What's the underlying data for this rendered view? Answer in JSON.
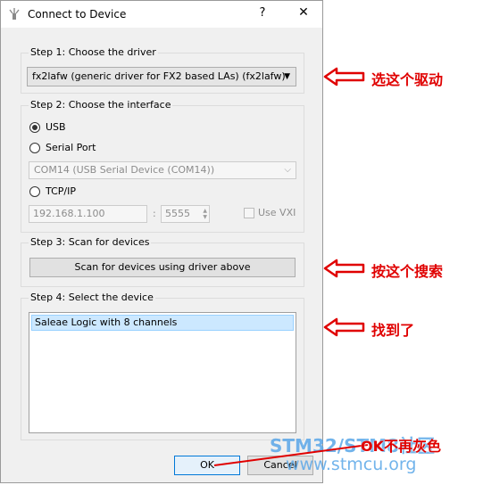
{
  "window": {
    "title": "Connect to Device",
    "help_glyph": "?",
    "close_glyph": "✕"
  },
  "step1": {
    "label": "Step 1: Choose the driver",
    "driver": "fx2lafw (generic driver for FX2 based LAs) (fx2lafw)"
  },
  "step2": {
    "label": "Step 2: Choose the interface",
    "usb_label": "USB",
    "serial_label": "Serial Port",
    "serial_port": "COM14 (USB Serial Device (COM14))",
    "tcp_label": "TCP/IP",
    "host": "192.168.1.100",
    "separator": ":",
    "port": "5555",
    "vxi_label": "Use VXI"
  },
  "step3": {
    "label": "Step 3: Scan for devices",
    "scan_button": "Scan for devices using driver above"
  },
  "step4": {
    "label": "Step 4: Select the device",
    "devices": [
      "Saleae Logic with 8 channels"
    ]
  },
  "buttons": {
    "ok": "OK",
    "cancel": "Cancel"
  },
  "annotations": {
    "driver_note": "选这个驱动",
    "scan_note": "按这个搜索",
    "found_note": "找到了",
    "ok_note": "OK不再灰色"
  },
  "watermark": {
    "line1": "STM32/STM8社区",
    "line2": "www.stmcu.org"
  },
  "colors": {
    "annotation": "#e00000",
    "selection": "#cce8ff",
    "watermark": "#5aa7e8"
  }
}
